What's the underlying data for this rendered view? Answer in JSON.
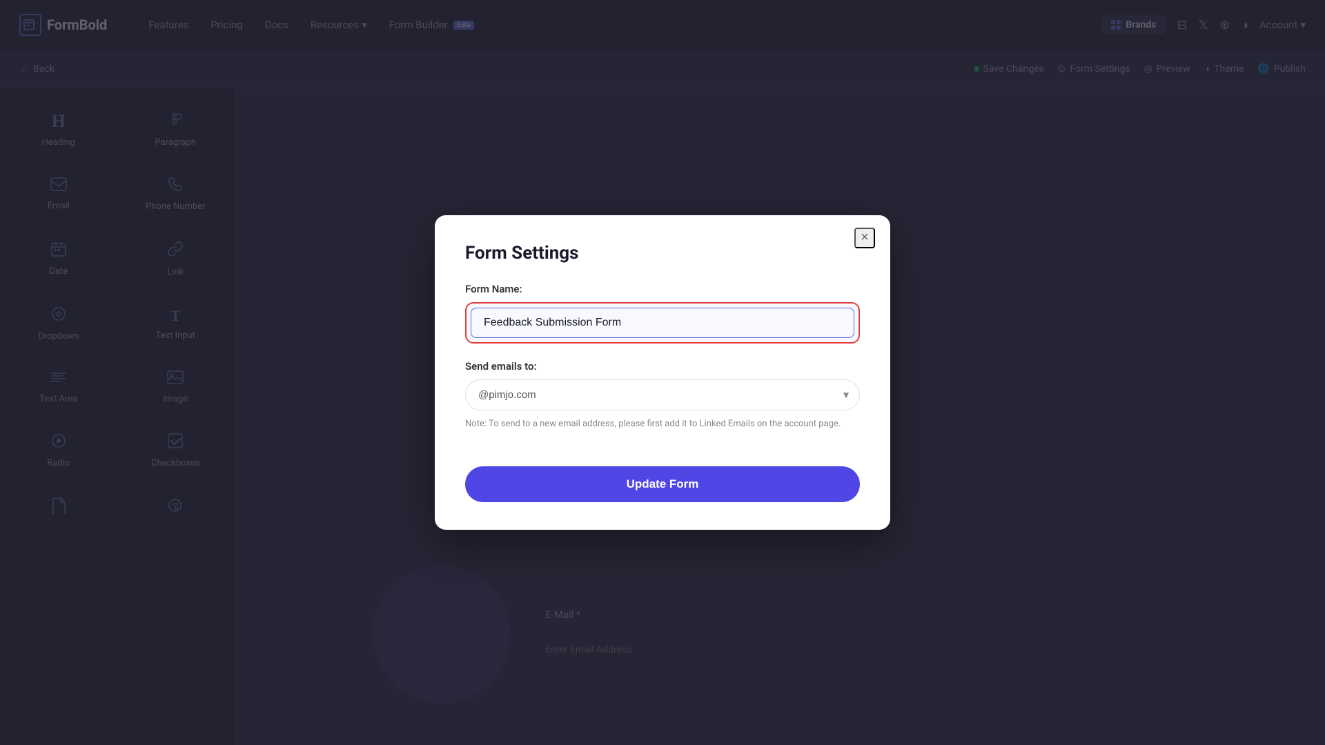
{
  "navbar": {
    "logo_text": "FormBold",
    "logo_icon": "B",
    "nav_items": [
      {
        "label": "Features",
        "active": false
      },
      {
        "label": "Pricing",
        "active": false
      },
      {
        "label": "Docs",
        "active": false
      },
      {
        "label": "Resources",
        "active": false,
        "has_chevron": true
      },
      {
        "label": "Form Builder",
        "active": false,
        "badge": "Beta"
      }
    ],
    "brand_button": "Brands",
    "account_button": "Account"
  },
  "toolbar": {
    "back_label": "Back",
    "save_changes_label": "Save Changes",
    "form_settings_label": "Form Settings",
    "preview_label": "Preview",
    "theme_label": "Theme",
    "publish_label": "Publish"
  },
  "sidebar": {
    "items": [
      {
        "id": "heading",
        "label": "Heading",
        "icon": "H"
      },
      {
        "id": "paragraph",
        "label": "Paragraph",
        "icon": "¶"
      },
      {
        "id": "email",
        "label": "Email",
        "icon": "✉"
      },
      {
        "id": "phone-number",
        "label": "Phone Number",
        "icon": "✆"
      },
      {
        "id": "date",
        "label": "Date",
        "icon": "📅"
      },
      {
        "id": "link",
        "label": "Link",
        "icon": "🔗"
      },
      {
        "id": "dropdown",
        "label": "Dropdown",
        "icon": "⊙"
      },
      {
        "id": "text-input",
        "label": "Text Input",
        "icon": "T"
      },
      {
        "id": "text-area",
        "label": "Text Area",
        "icon": "≡"
      },
      {
        "id": "image",
        "label": "Image",
        "icon": "🖼"
      },
      {
        "id": "radio",
        "label": "Radio",
        "icon": "◎"
      },
      {
        "id": "checkboxes",
        "label": "Checkboxes",
        "icon": "☑"
      },
      {
        "id": "file-1",
        "label": "",
        "icon": "📄"
      },
      {
        "id": "file-2",
        "label": "",
        "icon": "📎"
      }
    ]
  },
  "canvas": {
    "email_label": "E-Mail *",
    "email_placeholder": "Enter Email Address"
  },
  "modal": {
    "title": "Form Settings",
    "close_label": "×",
    "form_name_label": "Form Name:",
    "form_name_value": "Feedback Submission Form",
    "send_emails_label": "Send emails to:",
    "email_value": "@pimjo.com",
    "note_text": "Note: To send to a new email address, please first add it to Linked Emails on the account page.",
    "update_button_label": "Update Form",
    "email_options": [
      "@pimjo.com"
    ]
  }
}
